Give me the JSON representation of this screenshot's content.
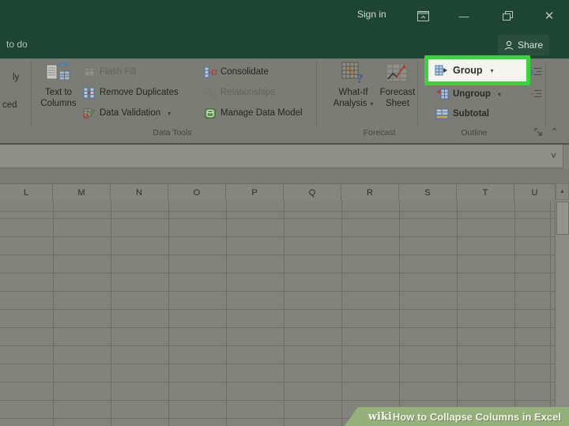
{
  "titlebar": {
    "sign_in": "Sign in"
  },
  "tab_row": {
    "tell_me_partial": "to do",
    "share_label": "Share"
  },
  "ribbon": {
    "reapply_partial": "ly",
    "advanced_partial": "ced",
    "text_to_columns_1": "Text to",
    "text_to_columns_2": "Columns",
    "flash_fill": "Flash Fill",
    "remove_duplicates": "Remove Duplicates",
    "data_validation": "Data Validation",
    "consolidate": "Consolidate",
    "relationships": "Relationships",
    "manage_data_model": "Manage Data Model",
    "what_if_1": "What-If",
    "what_if_2": "Analysis",
    "forecast_sheet_1": "Forecast",
    "forecast_sheet_2": "Sheet",
    "group_button": "Group",
    "ungroup_button": "Ungroup",
    "subtotal_button": "Subtotal",
    "labels": {
      "data_tools": "Data Tools",
      "forecast": "Forecast",
      "outline": "Outline"
    }
  },
  "grid": {
    "columns": [
      "L",
      "M",
      "N",
      "O",
      "P",
      "Q",
      "R",
      "S",
      "T",
      "U"
    ]
  },
  "caption": {
    "wiki": "wiki",
    "title": "How to Collapse Columns in Excel"
  },
  "colors": {
    "titlebar_green": "#1e4434",
    "highlight_green": "#38d438",
    "caption_green": "#94b07b",
    "ribbon_gray": "#7c7c76"
  },
  "icons": {
    "dropdown": "▾",
    "minimize": "—",
    "close": "✕",
    "formula_expand": "˅",
    "ribbon_collapse": "⌃",
    "scroll_up": "▲"
  }
}
